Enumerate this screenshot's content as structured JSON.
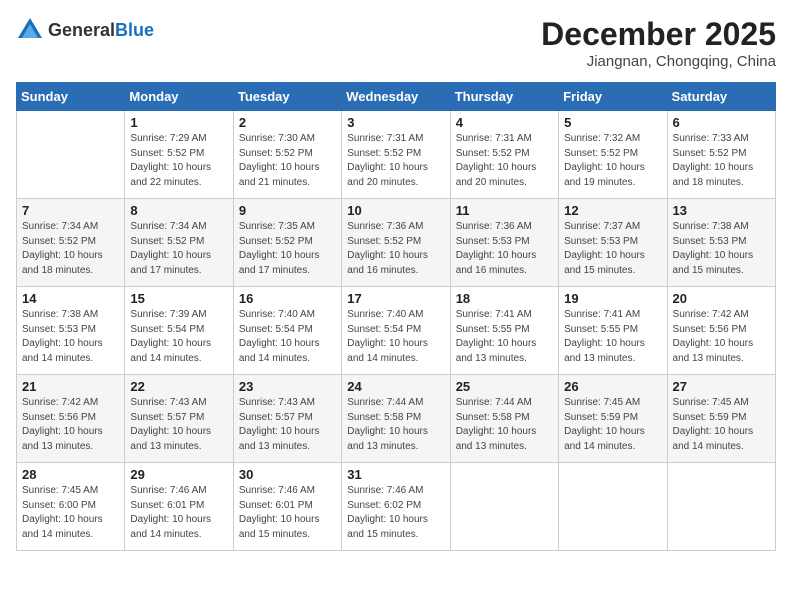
{
  "header": {
    "logo_general": "General",
    "logo_blue": "Blue",
    "month": "December 2025",
    "location": "Jiangnan, Chongqing, China"
  },
  "weekdays": [
    "Sunday",
    "Monday",
    "Tuesday",
    "Wednesday",
    "Thursday",
    "Friday",
    "Saturday"
  ],
  "weeks": [
    [
      {
        "day": "",
        "info": ""
      },
      {
        "day": "1",
        "info": "Sunrise: 7:29 AM\nSunset: 5:52 PM\nDaylight: 10 hours\nand 22 minutes."
      },
      {
        "day": "2",
        "info": "Sunrise: 7:30 AM\nSunset: 5:52 PM\nDaylight: 10 hours\nand 21 minutes."
      },
      {
        "day": "3",
        "info": "Sunrise: 7:31 AM\nSunset: 5:52 PM\nDaylight: 10 hours\nand 20 minutes."
      },
      {
        "day": "4",
        "info": "Sunrise: 7:31 AM\nSunset: 5:52 PM\nDaylight: 10 hours\nand 20 minutes."
      },
      {
        "day": "5",
        "info": "Sunrise: 7:32 AM\nSunset: 5:52 PM\nDaylight: 10 hours\nand 19 minutes."
      },
      {
        "day": "6",
        "info": "Sunrise: 7:33 AM\nSunset: 5:52 PM\nDaylight: 10 hours\nand 18 minutes."
      }
    ],
    [
      {
        "day": "7",
        "info": "Sunrise: 7:34 AM\nSunset: 5:52 PM\nDaylight: 10 hours\nand 18 minutes."
      },
      {
        "day": "8",
        "info": "Sunrise: 7:34 AM\nSunset: 5:52 PM\nDaylight: 10 hours\nand 17 minutes."
      },
      {
        "day": "9",
        "info": "Sunrise: 7:35 AM\nSunset: 5:52 PM\nDaylight: 10 hours\nand 17 minutes."
      },
      {
        "day": "10",
        "info": "Sunrise: 7:36 AM\nSunset: 5:52 PM\nDaylight: 10 hours\nand 16 minutes."
      },
      {
        "day": "11",
        "info": "Sunrise: 7:36 AM\nSunset: 5:53 PM\nDaylight: 10 hours\nand 16 minutes."
      },
      {
        "day": "12",
        "info": "Sunrise: 7:37 AM\nSunset: 5:53 PM\nDaylight: 10 hours\nand 15 minutes."
      },
      {
        "day": "13",
        "info": "Sunrise: 7:38 AM\nSunset: 5:53 PM\nDaylight: 10 hours\nand 15 minutes."
      }
    ],
    [
      {
        "day": "14",
        "info": "Sunrise: 7:38 AM\nSunset: 5:53 PM\nDaylight: 10 hours\nand 14 minutes."
      },
      {
        "day": "15",
        "info": "Sunrise: 7:39 AM\nSunset: 5:54 PM\nDaylight: 10 hours\nand 14 minutes."
      },
      {
        "day": "16",
        "info": "Sunrise: 7:40 AM\nSunset: 5:54 PM\nDaylight: 10 hours\nand 14 minutes."
      },
      {
        "day": "17",
        "info": "Sunrise: 7:40 AM\nSunset: 5:54 PM\nDaylight: 10 hours\nand 14 minutes."
      },
      {
        "day": "18",
        "info": "Sunrise: 7:41 AM\nSunset: 5:55 PM\nDaylight: 10 hours\nand 13 minutes."
      },
      {
        "day": "19",
        "info": "Sunrise: 7:41 AM\nSunset: 5:55 PM\nDaylight: 10 hours\nand 13 minutes."
      },
      {
        "day": "20",
        "info": "Sunrise: 7:42 AM\nSunset: 5:56 PM\nDaylight: 10 hours\nand 13 minutes."
      }
    ],
    [
      {
        "day": "21",
        "info": "Sunrise: 7:42 AM\nSunset: 5:56 PM\nDaylight: 10 hours\nand 13 minutes."
      },
      {
        "day": "22",
        "info": "Sunrise: 7:43 AM\nSunset: 5:57 PM\nDaylight: 10 hours\nand 13 minutes."
      },
      {
        "day": "23",
        "info": "Sunrise: 7:43 AM\nSunset: 5:57 PM\nDaylight: 10 hours\nand 13 minutes."
      },
      {
        "day": "24",
        "info": "Sunrise: 7:44 AM\nSunset: 5:58 PM\nDaylight: 10 hours\nand 13 minutes."
      },
      {
        "day": "25",
        "info": "Sunrise: 7:44 AM\nSunset: 5:58 PM\nDaylight: 10 hours\nand 13 minutes."
      },
      {
        "day": "26",
        "info": "Sunrise: 7:45 AM\nSunset: 5:59 PM\nDaylight: 10 hours\nand 14 minutes."
      },
      {
        "day": "27",
        "info": "Sunrise: 7:45 AM\nSunset: 5:59 PM\nDaylight: 10 hours\nand 14 minutes."
      }
    ],
    [
      {
        "day": "28",
        "info": "Sunrise: 7:45 AM\nSunset: 6:00 PM\nDaylight: 10 hours\nand 14 minutes."
      },
      {
        "day": "29",
        "info": "Sunrise: 7:46 AM\nSunset: 6:01 PM\nDaylight: 10 hours\nand 14 minutes."
      },
      {
        "day": "30",
        "info": "Sunrise: 7:46 AM\nSunset: 6:01 PM\nDaylight: 10 hours\nand 15 minutes."
      },
      {
        "day": "31",
        "info": "Sunrise: 7:46 AM\nSunset: 6:02 PM\nDaylight: 10 hours\nand 15 minutes."
      },
      {
        "day": "",
        "info": ""
      },
      {
        "day": "",
        "info": ""
      },
      {
        "day": "",
        "info": ""
      }
    ]
  ]
}
